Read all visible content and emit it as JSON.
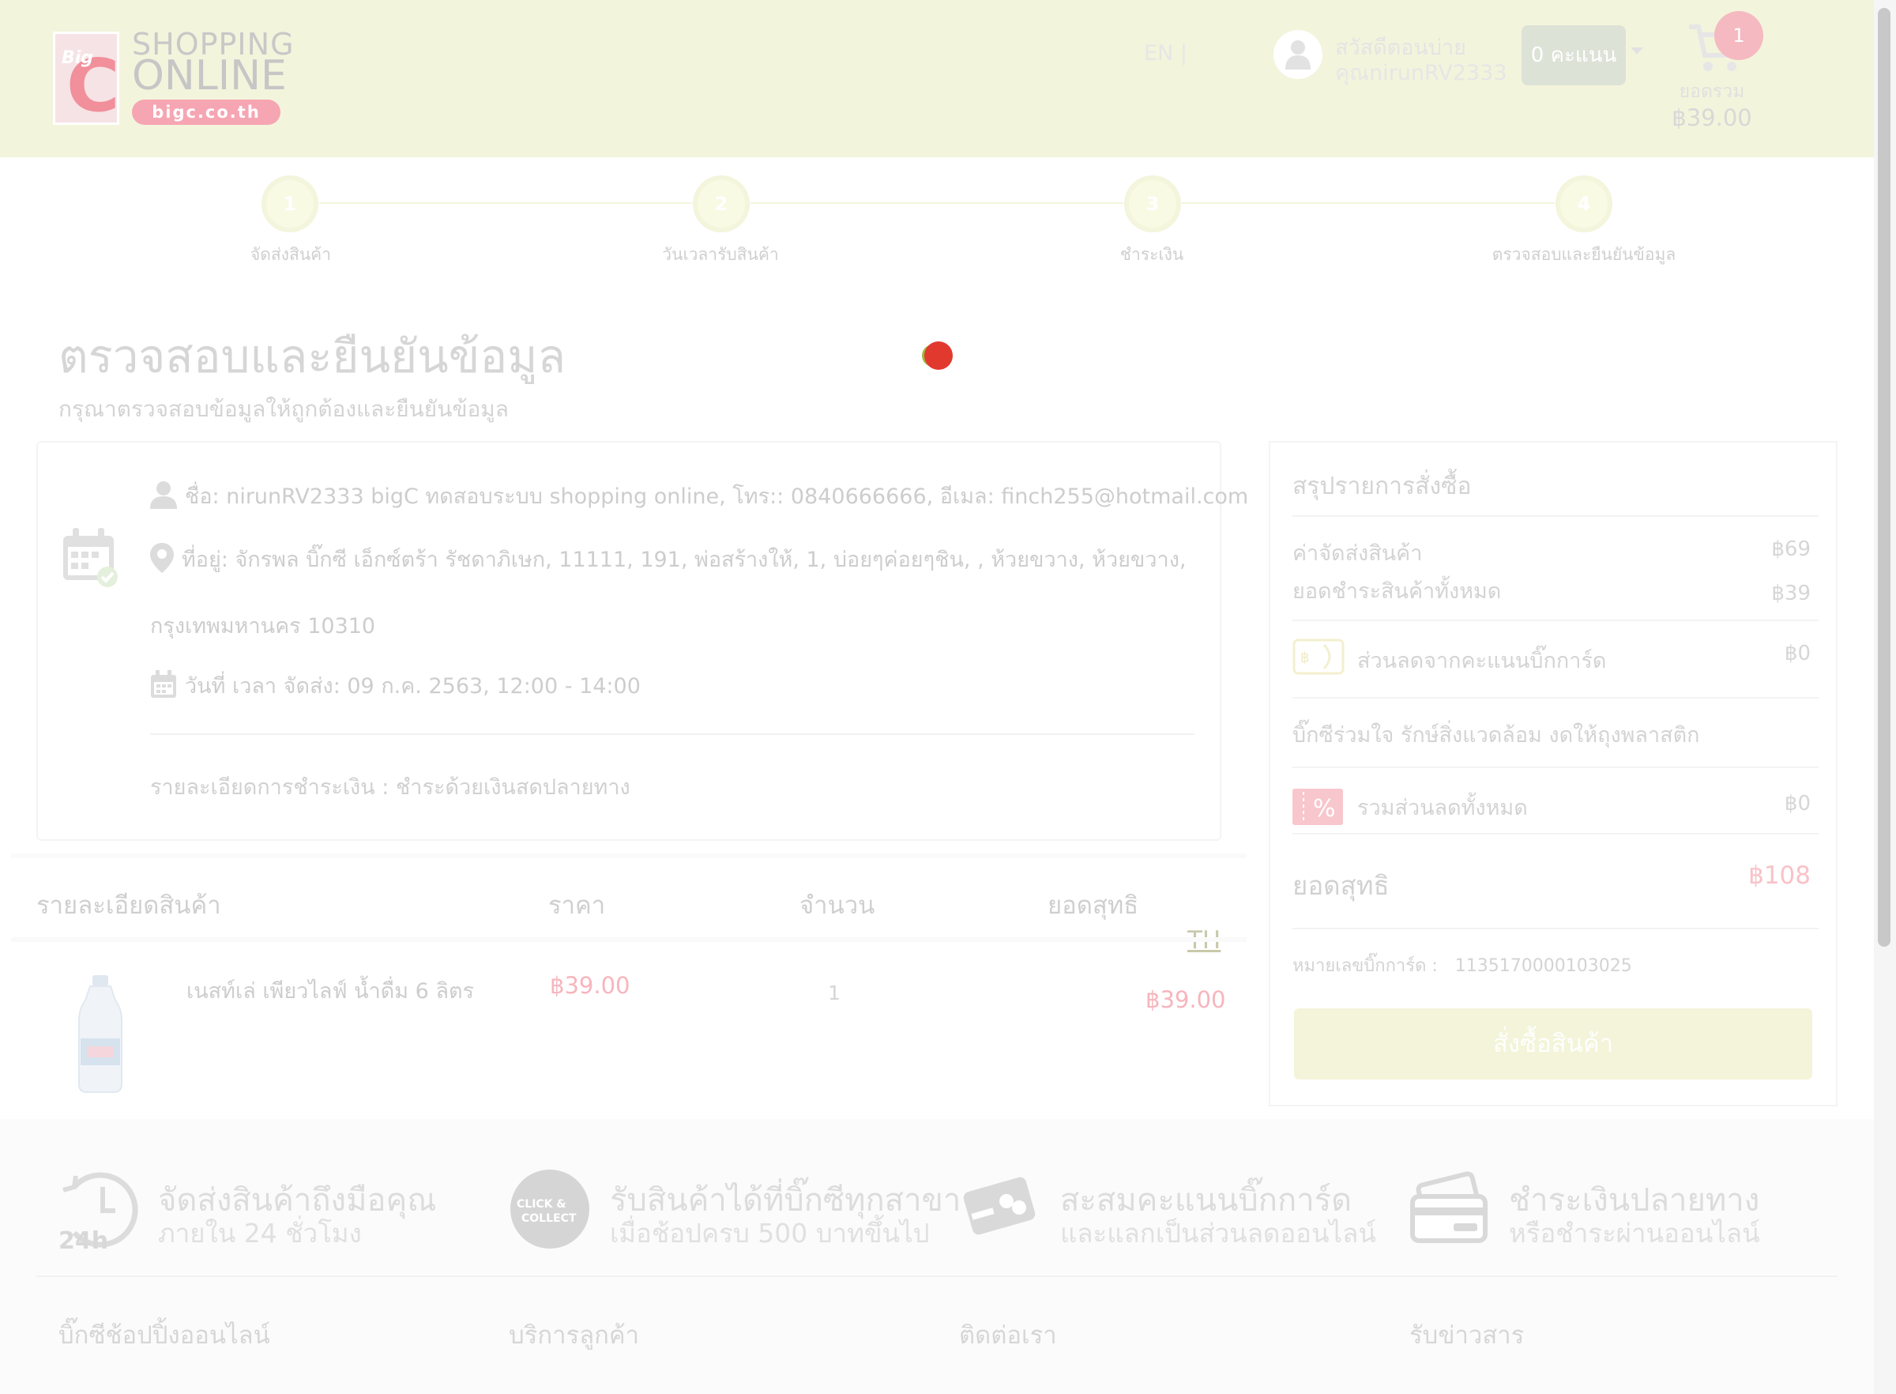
{
  "header": {
    "logo": {
      "big_text": "Big",
      "c_letter": "C",
      "line1": "SHOPPING",
      "line2": "ONLINE",
      "domain": "bigc.co.th"
    },
    "lang": {
      "en": "EN",
      "sep": "|",
      "th": "TH"
    },
    "greeting": {
      "line1": "สวัสดีตอนบ่าย",
      "line2": "คุณnirunRV2333"
    },
    "points_label": "0 คะแนน",
    "cart": {
      "badge": "1",
      "label": "ยอดรวม",
      "total": "฿39.00"
    }
  },
  "steps": [
    {
      "num": "1",
      "label": "จัดส่งสินค้า"
    },
    {
      "num": "2",
      "label": "วันเวลารับสินค้า"
    },
    {
      "num": "3",
      "label": "ชำระเงิน"
    },
    {
      "num": "4",
      "label": "ตรวจสอบและยืนยันข้อมูล"
    }
  ],
  "page": {
    "title": "ตรวจสอบและยืนยันข้อมูล",
    "subtitle": "กรุณาตรวจสอบข้อมูลให้ถูกต้องและยืนยันข้อมูล"
  },
  "info": {
    "name_line": "ชื่อ: nirunRV2333 bigC ทดสอบระบบ shopping online, โทร:: 0840666666, อีเมล: finch255@hotmail.com",
    "address_line1": "ที่อยู่: จักรพล บิ๊กซี เอ็กซ์ตร้า รัชดาภิเษก, 11111, 191, พ่อสร้างให้, 1, บ่อยๆค่อยๆชิน, , ห้วยขวาง, ห้วยขวาง,",
    "address_line2": "กรุงเทพมหานคร 10310",
    "delivery_line": "วันที่ เวลา จัดส่ง: 09 ก.ค. 2563, 12:00 - 14:00",
    "payment_line": "รายละเอียดการชำระเงิน : ชำระด้วยเงินสดปลายทาง"
  },
  "table": {
    "headers": {
      "detail": "รายละเอียดสินค้า",
      "price": "ราคา",
      "qty": "จำนวน",
      "total": "ยอดสุทธิ"
    },
    "rows": [
      {
        "name": "เนสท์เล่ เพียวไลฟ์ น้ำดื่ม 6 ลิตร",
        "price": "฿39.00",
        "qty": "1",
        "total": "฿39.00"
      }
    ]
  },
  "summary": {
    "title": "สรุปรายการสั่งซื้อ",
    "shipping_label": "ค่าจัดส่งสินค้า",
    "shipping_value": "฿69",
    "items_label": "ยอดชำระสินค้าทั้งหมด",
    "items_value": "฿39",
    "points_discount_label": "ส่วนลดจากคะแนนบิ๊กการ์ด",
    "points_discount_value": "฿0",
    "plastic_note": "บิ๊กซีร่วมใจ รักษ์สิ่งแวดล้อม งดให้ถุงพลาสติก",
    "total_discount_label": "รวมส่วนลดทั้งหมด",
    "total_discount_value": "฿0",
    "net_label": "ยอดสุทธิ",
    "net_value": "฿108",
    "card_label": "หมายเลขบิ๊กการ์ด :",
    "card_value": "1135170000103025",
    "order_button": "สั่งซื้อสินค้า"
  },
  "features": [
    {
      "title": "จัดส่งสินค้าถึงมือคุณ",
      "sub": "ภายใน 24 ชั่วโมง",
      "icon": "clock-24h-icon",
      "icon_text": "24h"
    },
    {
      "title": "รับสินค้าได้ที่บิ๊กซีทุกสาขา",
      "sub": "เมื่อช้อปครบ 500 บาทขึ้นไป",
      "icon": "click-collect-icon",
      "icon_text": "CLICK & COLLECT"
    },
    {
      "title": "สะสมคะแนนบิ๊กการ์ด",
      "sub": "และแลกเป็นส่วนลดออนไลน์",
      "icon": "bigcard-icon"
    },
    {
      "title": "ชำระเงินปลายทาง",
      "sub": "หรือชำระผ่านออนไลน์",
      "icon": "wallet-icon"
    }
  ],
  "footer": {
    "columns": [
      "บิ๊กซีช้อปปิ้งออนไลน์",
      "บริการลูกค้า",
      "ติดต่อเรา",
      "รับข่าวสาร"
    ]
  },
  "colors": {
    "header_bg": "#f3f4dc",
    "price_pink": "#f7b5bd",
    "button_bg": "#f3f4d9",
    "record_dot": "#e2392f"
  }
}
